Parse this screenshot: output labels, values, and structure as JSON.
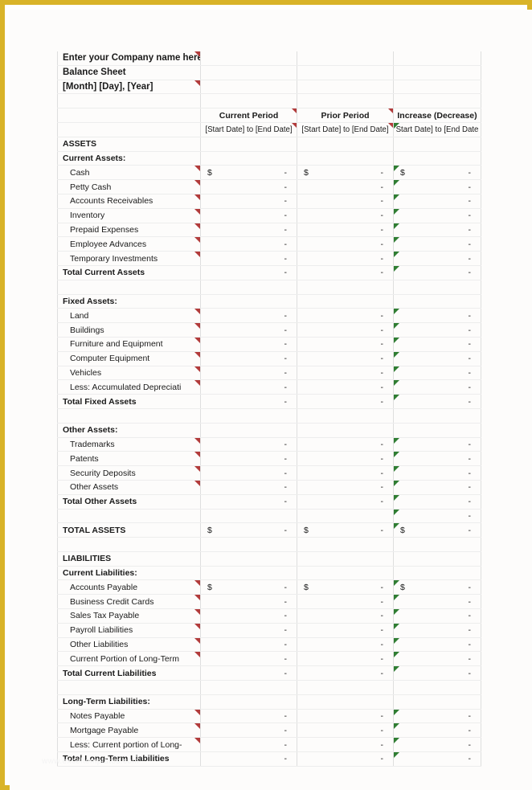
{
  "page": {
    "frame_color": "#d9b42a",
    "background": "#ffffff",
    "watermark": "www.exceltemplates.com"
  },
  "header": {
    "company_line": "Enter your Company name here",
    "doc_title": "Balance Sheet",
    "date_line": "[Month] [Day], [Year]"
  },
  "columns": {
    "label": "",
    "current": {
      "title": "Current Period",
      "range": "[Start Date] to [End Date]"
    },
    "prior": {
      "title": "Prior Period",
      "range": "[Start Date] to [End Date]"
    },
    "increase": {
      "title": "Increase (Decrease)",
      "range": "Start Date] to [End Date"
    }
  },
  "symbols": {
    "currency": "$",
    "empty_value": "-"
  },
  "sections": {
    "assets_heading": "ASSETS",
    "current_assets_heading": "Current Assets:",
    "current_assets_items": [
      "Cash",
      "Petty Cash",
      "Accounts Receivables",
      "Inventory",
      "Prepaid Expenses",
      "Employee Advances",
      "Temporary Investments"
    ],
    "total_current_assets": "Total Current Assets",
    "fixed_assets_heading": "Fixed Assets:",
    "fixed_assets_items": [
      "Land",
      "Buildings",
      "Furniture and Equipment",
      "Computer Equipment",
      "Vehicles",
      "Less: Accumulated Depreciati"
    ],
    "total_fixed_assets": "Total Fixed Assets",
    "other_assets_heading": "Other Assets:",
    "other_assets_items": [
      "Trademarks",
      "Patents",
      "Security Deposits",
      "Other Assets"
    ],
    "total_other_assets": "Total Other Assets",
    "total_assets": "TOTAL ASSETS",
    "liabilities_heading": "LIABILITIES",
    "current_liabilities_heading": "Current Liabilities:",
    "current_liabilities_items": [
      "Accounts Payable",
      "Business Credit Cards",
      "Sales Tax Payable",
      "Payroll Liabilities",
      "Other Liabilities",
      "Current Portion of Long-Term"
    ],
    "total_current_liabilities": "Total Current Liabilities",
    "long_term_liabilities_heading": "Long-Term Liabilities:",
    "long_term_liabilities_items": [
      "Notes Payable",
      "Mortgage Payable",
      "Less: Current portion of Long-"
    ],
    "total_long_term_liabilities": "Total Long-Term Liabilities"
  }
}
